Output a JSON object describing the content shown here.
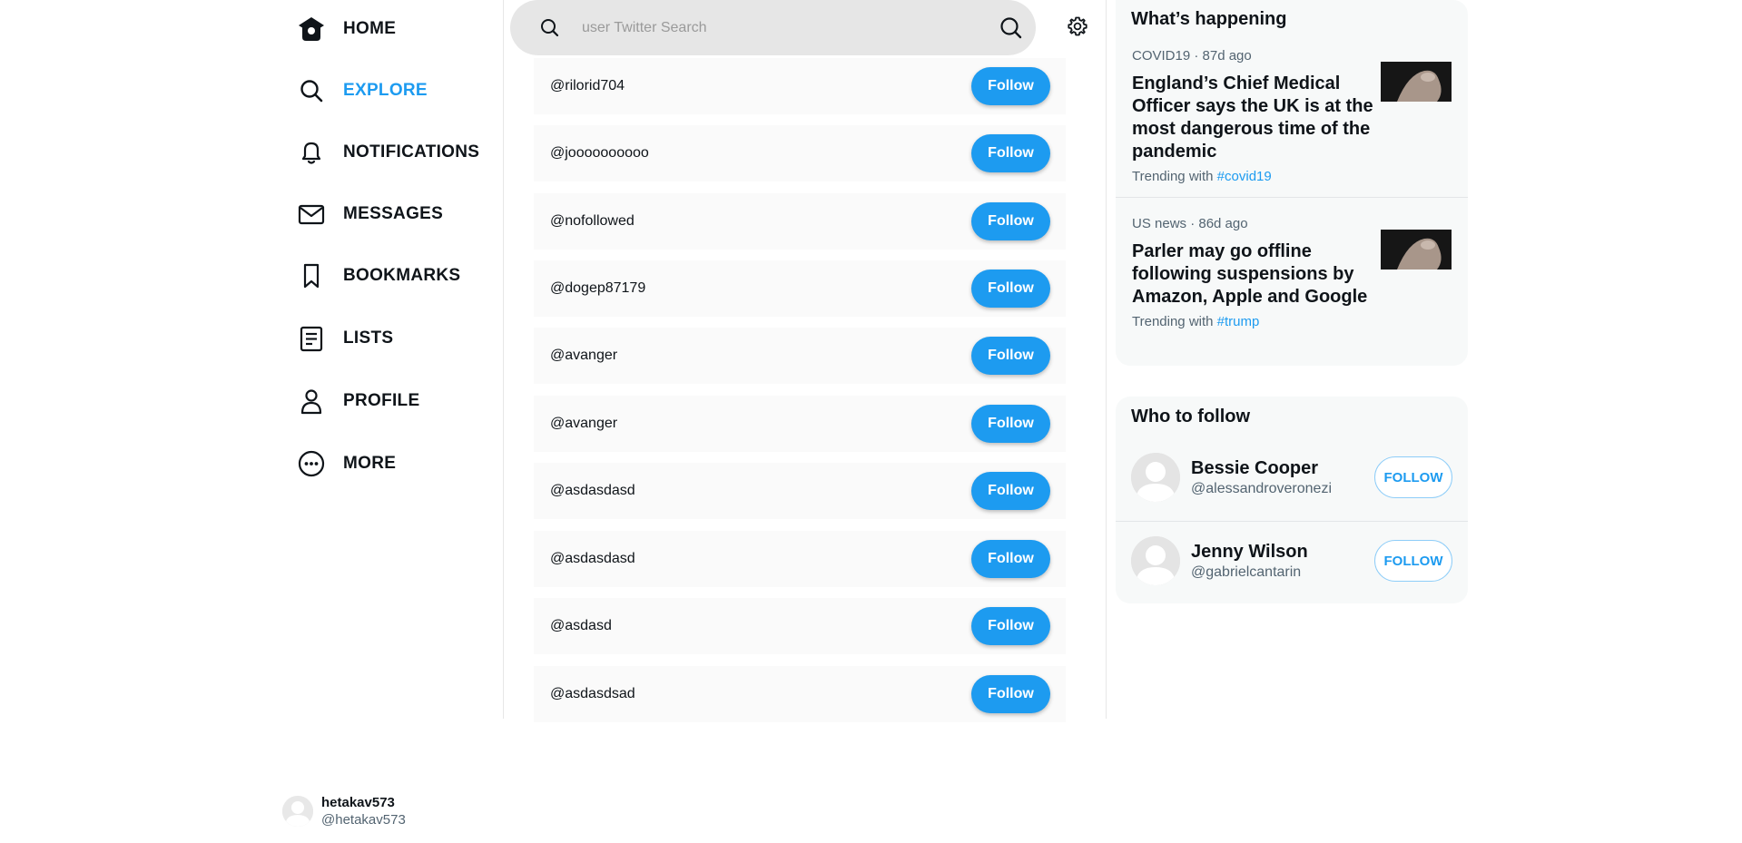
{
  "nav": {
    "items": [
      {
        "label": "HOME",
        "icon": "home-icon"
      },
      {
        "label": "EXPLORE",
        "icon": "search-icon",
        "active": true
      },
      {
        "label": "NOTIFICATIONS",
        "icon": "bell-icon"
      },
      {
        "label": "MESSAGES",
        "icon": "mail-icon"
      },
      {
        "label": "BOOKMARKS",
        "icon": "bookmark-icon"
      },
      {
        "label": "LISTS",
        "icon": "list-icon"
      },
      {
        "label": "PROFILE",
        "icon": "user-icon"
      },
      {
        "label": "MORE",
        "icon": "more-icon"
      }
    ]
  },
  "account": {
    "name": "hetakav573",
    "handle": "@hetakav573"
  },
  "search": {
    "placeholder": "user Twitter Search",
    "value": ""
  },
  "users": {
    "follow_label": "Follow",
    "rows": [
      {
        "handle": "@rilorid704"
      },
      {
        "handle": "@joooooooooo"
      },
      {
        "handle": "@nofollowed"
      },
      {
        "handle": "@dogep87179"
      },
      {
        "handle": "@avanger"
      },
      {
        "handle": "@avanger"
      },
      {
        "handle": "@asdasdasd"
      },
      {
        "handle": "@asdasdasd"
      },
      {
        "handle": "@asdasd"
      },
      {
        "handle": "@asdasdsad"
      }
    ]
  },
  "happening": {
    "title": "What’s happening",
    "trends": [
      {
        "meta": "COVID19 · 87d ago",
        "title": "England’s Chief Medical Officer says the UK is at the most dangerous time of the pandemic",
        "trending_prefix": "Trending with",
        "tag": "#covid19"
      },
      {
        "meta": "US news · 86d ago",
        "title": "Parler may go offline following suspensions by Amazon, Apple and Google",
        "trending_prefix": "Trending with",
        "tag": "#trump"
      }
    ]
  },
  "who_to_follow": {
    "title": "Who to follow",
    "button_label": "FOLLOW",
    "people": [
      {
        "name": "Bessie Cooper",
        "handle": "@alessandroveronezi"
      },
      {
        "name": "Jenny Wilson",
        "handle": "@gabrielcantarin"
      }
    ]
  },
  "colors": {
    "accent": "#1d9bf0",
    "search_bg": "#e6e6e6",
    "panel_bg": "#f7f9f9",
    "row_bg": "#fafafa"
  }
}
